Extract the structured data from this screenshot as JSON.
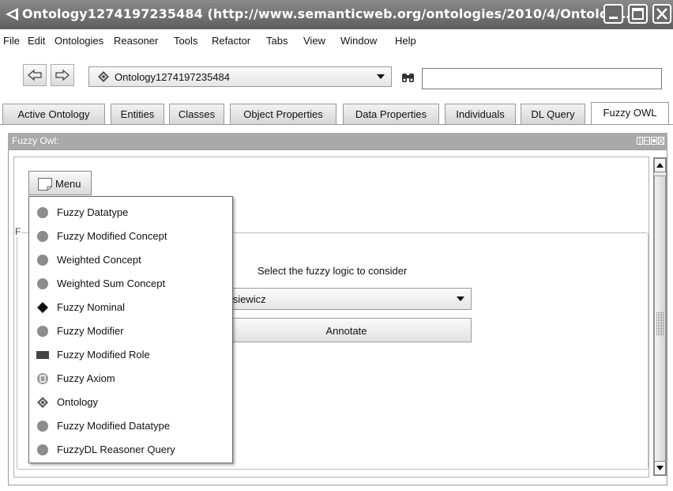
{
  "window": {
    "title": "Ontology1274197235484 (http://www.semanticweb.org/ontologies/2010/4/Ontolog…"
  },
  "menubar": {
    "items": [
      "File",
      "Edit",
      "Ontologies",
      "Reasoner",
      "Tools",
      "Refactor",
      "Tabs",
      "View",
      "Window",
      "Help"
    ]
  },
  "toolbar": {
    "ontology_selected": "Ontology1274197235484",
    "search_value": ""
  },
  "tabs": [
    {
      "label": "Active Ontology",
      "active": false
    },
    {
      "label": "Entities",
      "active": false
    },
    {
      "label": "Classes",
      "active": false
    },
    {
      "label": "Object Properties",
      "active": false
    },
    {
      "label": "Data Properties",
      "active": false
    },
    {
      "label": "Individuals",
      "active": false
    },
    {
      "label": "DL Query",
      "active": false
    },
    {
      "label": "Fuzzy OWL",
      "active": true
    }
  ],
  "view": {
    "title": "Fuzzy Owl:",
    "menu_button_label": "Menu",
    "fieldset_legend": "F",
    "select_label": "Select the fuzzy logic to consider",
    "logic_value": "kasiewicz",
    "annotate_label": "Annotate"
  },
  "popup_menu": [
    {
      "label": "Fuzzy Datatype",
      "icon": "gray-circle-icon"
    },
    {
      "label": "Fuzzy Modified Concept",
      "icon": "gray-circle-icon"
    },
    {
      "label": "Weighted Concept",
      "icon": "gray-circle-icon"
    },
    {
      "label": "Weighted Sum Concept",
      "icon": "gray-circle-icon"
    },
    {
      "label": "Fuzzy Nominal",
      "icon": "black-diamond-icon"
    },
    {
      "label": "Fuzzy Modifier",
      "icon": "gray-circle-icon"
    },
    {
      "label": "Fuzzy Modified Role",
      "icon": "rectangle-icon"
    },
    {
      "label": "Fuzzy Axiom",
      "icon": "axiom-icon"
    },
    {
      "label": "Ontology",
      "icon": "ontology-diamond-icon"
    },
    {
      "label": "Fuzzy Modified Datatype",
      "icon": "gray-circle-icon"
    },
    {
      "label": "FuzzyDL Reasoner Query",
      "icon": "gray-circle-icon"
    }
  ],
  "colors": {
    "titlebar": "#6e6e6e",
    "view_header": "#a9a9a9",
    "icon_gray": "#8c8c8c"
  }
}
